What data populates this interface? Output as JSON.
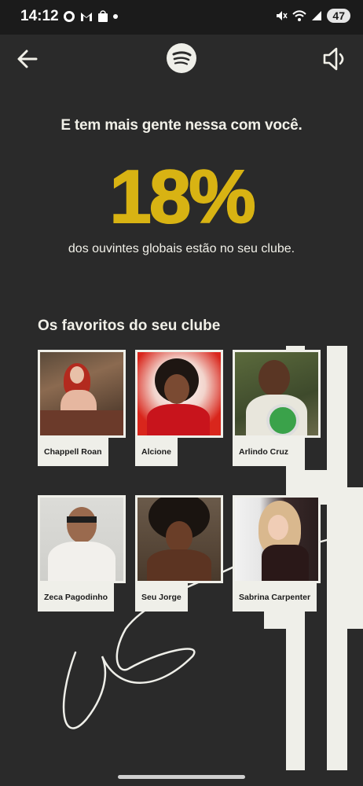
{
  "status_bar": {
    "time": "14:12",
    "battery": "47"
  },
  "nav": {
    "back_icon": "arrow-left-icon",
    "logo_icon": "spotify-logo-icon",
    "sound_icon": "speaker-icon"
  },
  "story": {
    "headline": "E tem mais gente nessa com você.",
    "percent": "18%",
    "subtext": "dos ouvintes globais estão no seu clube.",
    "section_title": "Os favoritos do seu clube"
  },
  "artists": [
    {
      "name": "Chappell Roan"
    },
    {
      "name": "Alcione"
    },
    {
      "name": "Arlindo Cruz"
    },
    {
      "name": "Zeca Pagodinho"
    },
    {
      "name": "Seu Jorge"
    },
    {
      "name": "Sabrina Carpenter"
    }
  ],
  "colors": {
    "background": "#2a2a2a",
    "accent_yellow": "#d8b313",
    "cream": "#efefe9"
  }
}
